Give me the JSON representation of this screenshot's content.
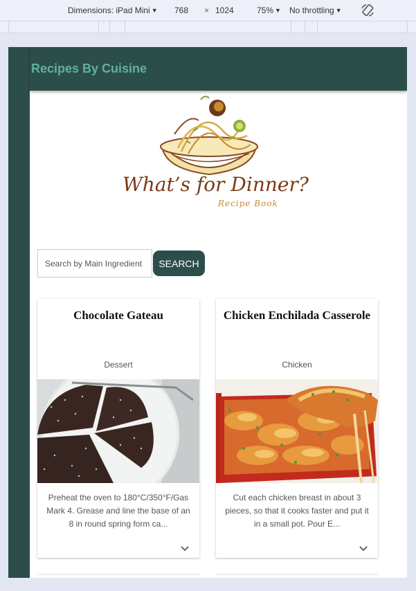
{
  "devtools": {
    "dimensions_label": "Dimensions: iPad Mini",
    "width": "768",
    "times": "×",
    "height": "1024",
    "zoom": "75%",
    "throttling": "No throttling"
  },
  "app": {
    "title": "Recipes By Cuisine",
    "logo_text": "What’s for Dinner?",
    "logo_subtext": "Recipe Book"
  },
  "search": {
    "placeholder": "Search by Main Ingredient",
    "button_label": "SEARCH"
  },
  "recipes": [
    {
      "title": "Chocolate Gateau",
      "category": "Dessert",
      "excerpt": "Preheat the oven to 180°C/350°F/Gas Mark 4. Grease and line the base of an 8 in round spring form ca..."
    },
    {
      "title": "Chicken Enchilada Casserole",
      "category": "Chicken",
      "excerpt": "Cut each chicken breast in about 3 pieces, so that it cooks faster and put it in a small pot. Pour E..."
    }
  ],
  "colors": {
    "primary": "#2c4e4b",
    "title_accent": "#5fb0a3",
    "background": "#e3e7f3"
  }
}
